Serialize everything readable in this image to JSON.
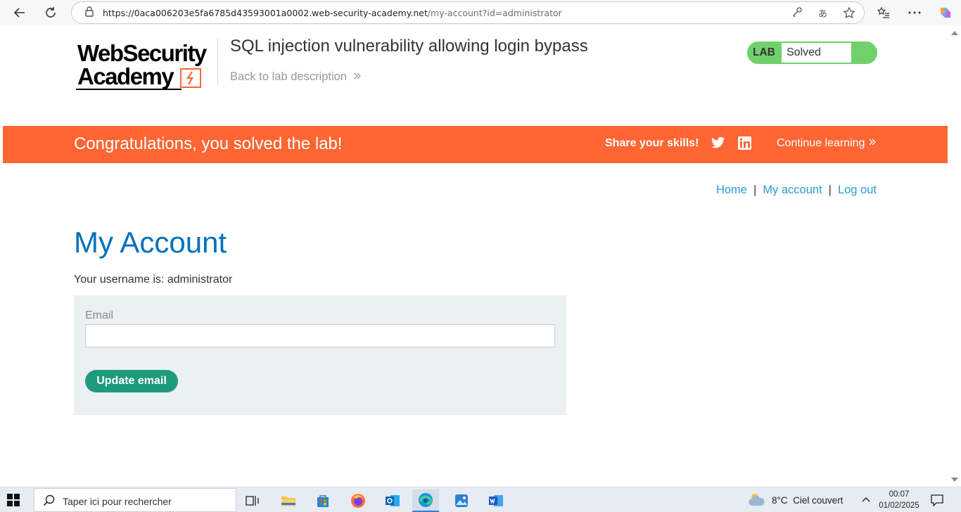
{
  "browser": {
    "url_host": "https://0aca006203e5fa6785d43593001a0002.web-security-academy.net",
    "url_path": "/my-account?id=administrator"
  },
  "header": {
    "logo_line1": "WebSecurity",
    "logo_line2": "Academy",
    "lab_title": "SQL injection vulnerability allowing login bypass",
    "back_link": "Back to lab description",
    "lab_badge": "LAB",
    "lab_status": "Solved"
  },
  "banner": {
    "message": "Congratulations, you solved the lab!",
    "share": "Share your skills!",
    "continue": "Continue learning"
  },
  "nav": {
    "home": "Home",
    "separator": "|",
    "my_account": "My account",
    "log_out": "Log out"
  },
  "main": {
    "title": "My Account",
    "username_line": "Your username is: administrator",
    "email_label": "Email",
    "email_value": "",
    "update_button": "Update email"
  },
  "taskbar": {
    "search_placeholder": "Taper ici pour rechercher",
    "weather": "8°C  Ciel couvert",
    "time": "00:07",
    "date": "01/02/2025"
  },
  "colors": {
    "accent_orange": "#ff6633",
    "link_blue": "#2a9bd6",
    "title_blue": "#0071bc",
    "solved_green": "#70d16a",
    "button_green": "#1e9b7d"
  }
}
